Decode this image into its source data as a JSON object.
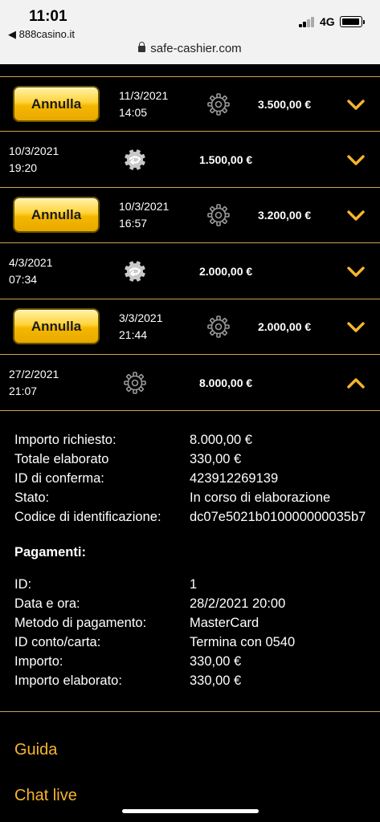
{
  "status_bar": {
    "time": "11:01",
    "back_app": "◀ 888casino.it",
    "network": "4G"
  },
  "browser": {
    "url": "safe-cashier.com"
  },
  "rows": [
    {
      "has_cancel": true,
      "date": "11/3/2021",
      "time": "14:05",
      "icon": "gear-icon",
      "amount": "3.500,00 €",
      "expanded": false
    },
    {
      "has_cancel": false,
      "date": "10/3/2021",
      "time": "19:20",
      "icon": "refund-icon",
      "amount": "1.500,00 €",
      "expanded": false
    },
    {
      "has_cancel": true,
      "date": "10/3/2021",
      "time": "16:57",
      "icon": "gear-icon",
      "amount": "3.200,00 €",
      "expanded": false
    },
    {
      "has_cancel": false,
      "date": "4/3/2021",
      "time": "07:34",
      "icon": "refund-icon",
      "amount": "2.000,00 €",
      "expanded": false
    },
    {
      "has_cancel": true,
      "date": "3/3/2021",
      "time": "21:44",
      "icon": "gear-icon",
      "amount": "2.000,00 €",
      "expanded": false
    },
    {
      "has_cancel": false,
      "date": "27/2/2021",
      "time": "21:07",
      "icon": "gear-icon",
      "amount": "8.000,00 €",
      "expanded": true
    }
  ],
  "cancel_label": "Annulla",
  "details": {
    "fields": [
      {
        "label": "Importo richiesto:",
        "value": "8.000,00 €"
      },
      {
        "label": "Totale elaborato",
        "value": "330,00 €"
      },
      {
        "label": "ID di conferma:",
        "value": "423912269139"
      },
      {
        "label": "Stato:",
        "value": "In corso di elaborazione"
      },
      {
        "label": "Codice di identificazione:",
        "value": "dc07e5021b010000000035b7"
      }
    ],
    "payments_title": "Pagamenti:",
    "payments": [
      {
        "label": "ID:",
        "value": "1"
      },
      {
        "label": "Data e ora:",
        "value": "28/2/2021 20:00"
      },
      {
        "label": "Metodo di pagamento:",
        "value": "MasterCard"
      },
      {
        "label": "ID conto/carta:",
        "value": "Termina con 0540"
      },
      {
        "label": "Importo:",
        "value": "330,00 €"
      },
      {
        "label": "Importo elaborato:",
        "value": "330,00 €"
      }
    ]
  },
  "footer_links": {
    "guide": "Guida",
    "chat": "Chat live"
  },
  "colors": {
    "accent": "#f7b52b",
    "divider": "#caa35a",
    "button_yellow": "#ffd23a"
  }
}
